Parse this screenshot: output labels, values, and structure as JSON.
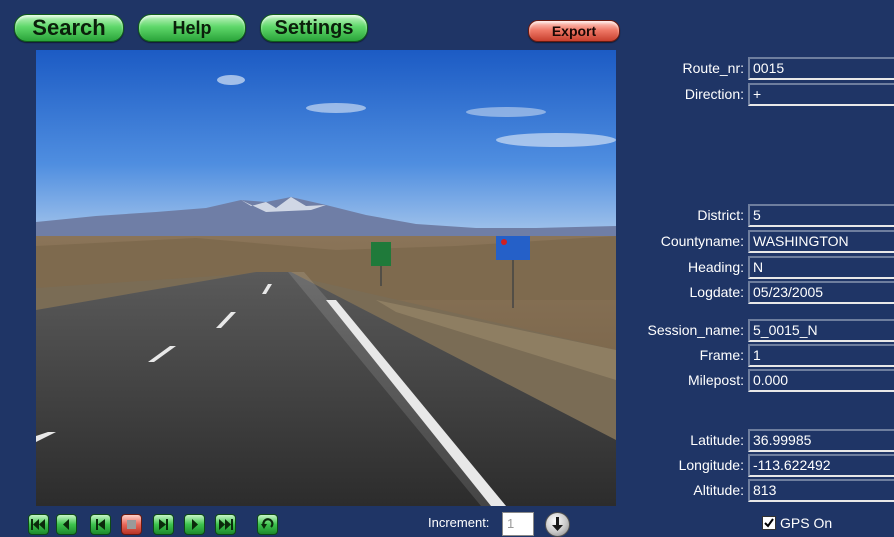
{
  "toolbar": {
    "search_label": "Search",
    "help_label": "Help",
    "settings_label": "Settings",
    "export_label": "Export"
  },
  "fields": {
    "route_nr": {
      "label": "Route_nr:",
      "value": "0015"
    },
    "direction": {
      "label": "Direction:",
      "value": "+"
    },
    "district": {
      "label": "District:",
      "value": "5"
    },
    "countyname": {
      "label": "Countyname:",
      "value": "WASHINGTON"
    },
    "heading": {
      "label": "Heading:",
      "value": "N"
    },
    "logdate": {
      "label": "Logdate:",
      "value": "05/23/2005"
    },
    "session_name": {
      "label": "Session_name:",
      "value": "5_0015_N"
    },
    "frame": {
      "label": "Frame:",
      "value": "1"
    },
    "milepost": {
      "label": "Milepost:",
      "value": "0.000"
    },
    "latitude": {
      "label": "Latitude:",
      "value": "36.99985"
    },
    "longitude": {
      "label": "Longitude:",
      "value": "-113.622492"
    },
    "altitude": {
      "label": "Altitude:",
      "value": "813"
    }
  },
  "playback": {
    "controls": [
      "first-frame-icon",
      "previous-icon",
      "step-back-icon",
      "stop-icon",
      "step-forward-icon",
      "play-icon",
      "last-frame-icon",
      "rewind-icon"
    ],
    "increment_label": "Increment:",
    "increment_value": "1"
  },
  "gps": {
    "label": "GPS On",
    "checked": true
  },
  "colors": {
    "background": "#1f3566",
    "green_button": "#3cc34c",
    "red_button": "#e8685a"
  }
}
